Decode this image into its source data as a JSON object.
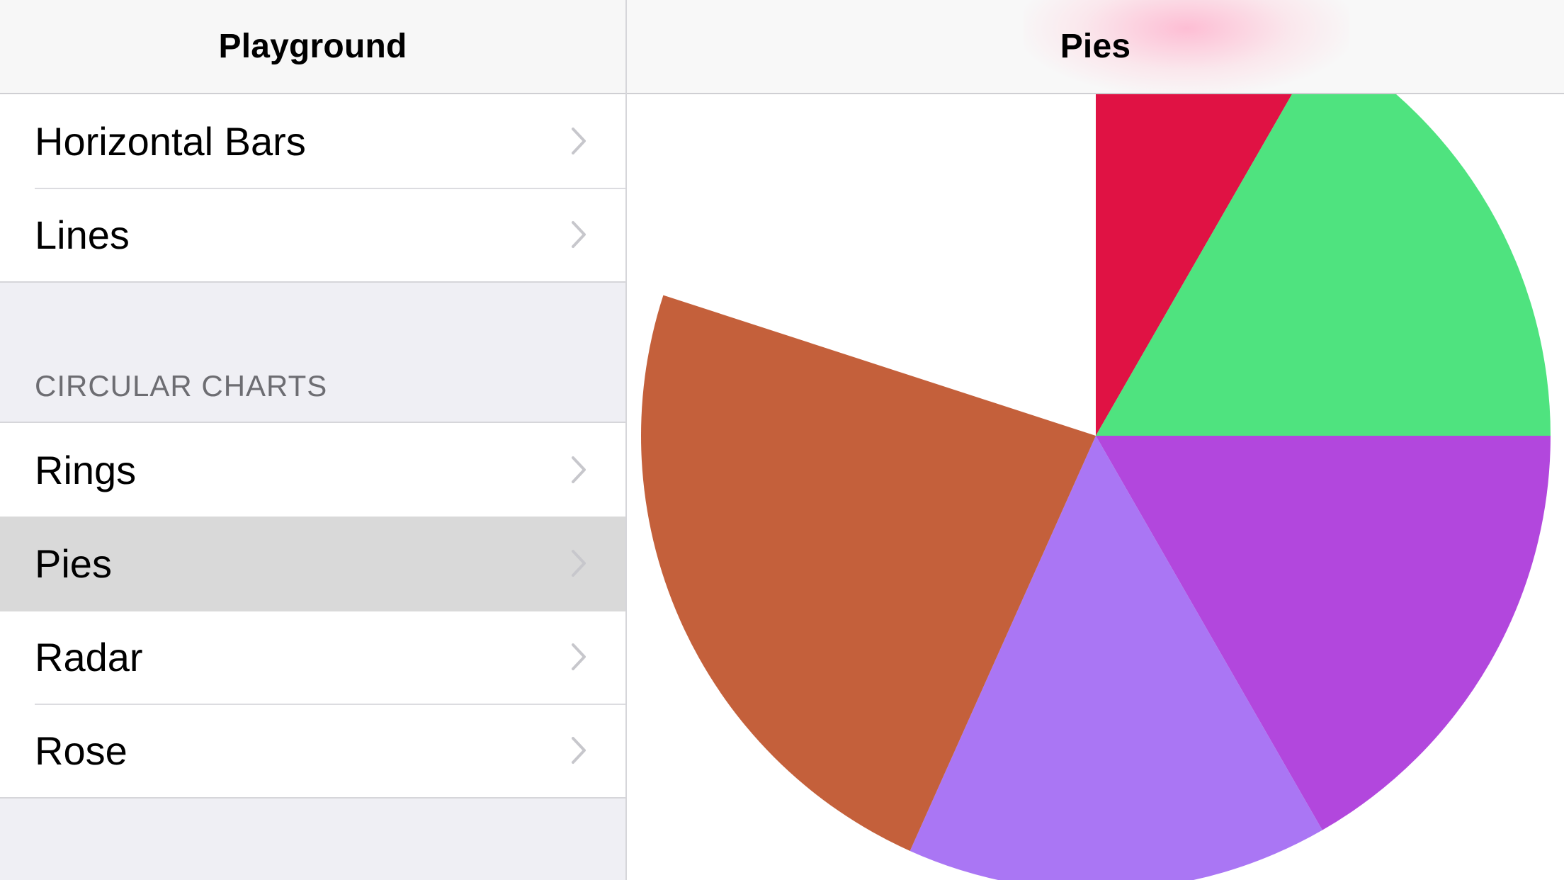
{
  "master": {
    "title": "Playground",
    "groups": [
      {
        "items": [
          {
            "label": "Horizontal Bars",
            "icon": "chevron-right-icon"
          },
          {
            "label": "Lines",
            "icon": "chevron-right-icon"
          }
        ]
      },
      {
        "header": "CIRCULAR CHARTS",
        "items": [
          {
            "label": "Rings",
            "icon": "chevron-right-icon"
          },
          {
            "label": "Pies",
            "icon": "chevron-right-icon",
            "selected": true
          },
          {
            "label": "Radar",
            "icon": "chevron-right-icon"
          },
          {
            "label": "Rose",
            "icon": "chevron-right-icon"
          }
        ]
      }
    ]
  },
  "detail": {
    "title": "Pies"
  },
  "colors": {
    "red": "#e01244",
    "green": "#4fe37f",
    "magenta": "#b247dd",
    "lavender": "#aa76f4",
    "orange": "#c4603b"
  },
  "chart_data": {
    "type": "pie",
    "slices": [
      {
        "value": 8.3,
        "color": "#e01244"
      },
      {
        "value": 16.7,
        "color": "#4fe37f"
      },
      {
        "value": 16.7,
        "color": "#b247dd"
      },
      {
        "value": 15.0,
        "color": "#aa76f4"
      },
      {
        "value": 23.3,
        "color": "#c4603b"
      }
    ],
    "total": 100,
    "start_angle_deg": 0,
    "direction": "clockwise"
  }
}
